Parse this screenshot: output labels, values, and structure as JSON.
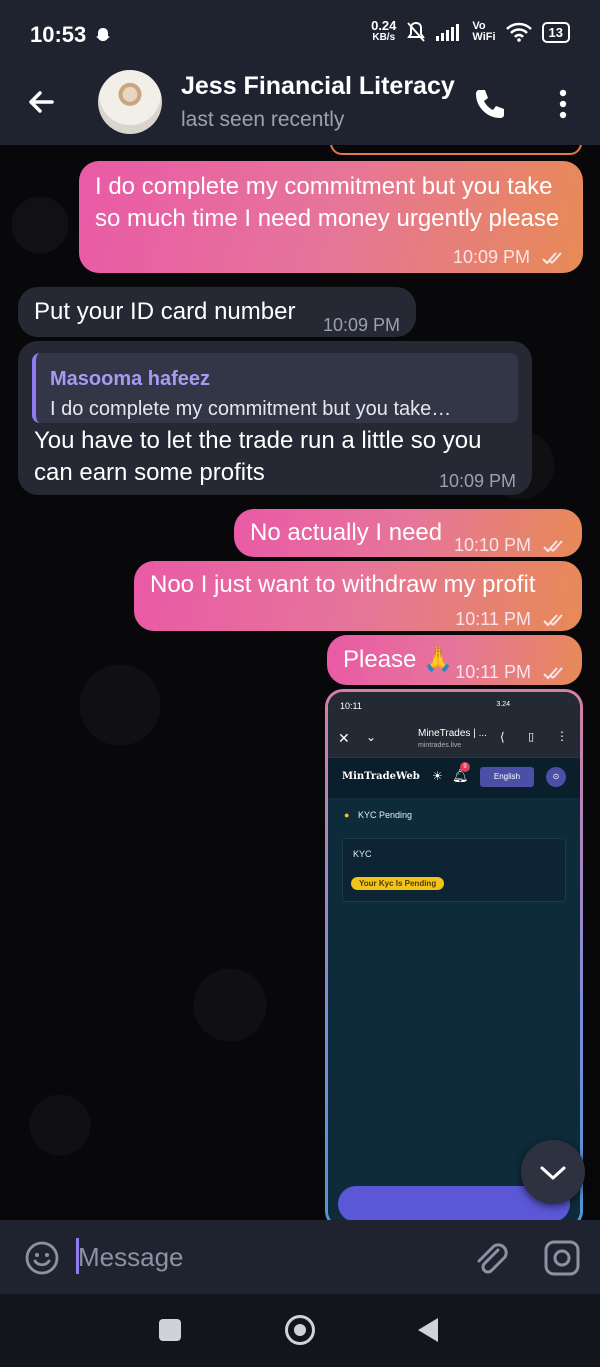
{
  "status_bar": {
    "time": "10:53",
    "net_speed_value": "0.24",
    "net_speed_unit": "KB/s",
    "carrier_top": "Vo",
    "carrier_bottom": "WiFi",
    "battery": "13"
  },
  "header": {
    "title": "Jess Financial Literacy",
    "subtitle": "last seen recently"
  },
  "messages": [
    {
      "dir": "out",
      "text": "I do complete my commitment but you take so much time I need money urgently please",
      "time": "10:09 PM"
    },
    {
      "dir": "in",
      "text": "Put your ID card number",
      "time": "10:09 PM"
    },
    {
      "dir": "in",
      "reply_author": "Masooma hafeez",
      "reply_text": "I do complete my commitment but you take…",
      "text": "You have to let the trade run a little so you can earn some profits",
      "time": "10:09 PM"
    },
    {
      "dir": "out",
      "text": "No actually I need",
      "time": "10:10 PM"
    },
    {
      "dir": "out",
      "text": "Noo I just want to withdraw my profit",
      "time": "10:11 PM"
    },
    {
      "dir": "out",
      "text": "Please 🙏",
      "time": "10:11 PM"
    }
  ],
  "screenshot_msg": {
    "status_time": "10:11",
    "net": "3.24",
    "site_title": "MineTrades | ...",
    "site_url": "mintrades.live",
    "brand": "MinTradeWeb",
    "notif_count": "9",
    "language": "English",
    "section_title": "KYC Pending",
    "card_title": "KYC",
    "badge": "Your Kyc Is Pending"
  },
  "input": {
    "placeholder": "Message"
  },
  "colors": {
    "accent": "#8f7cf0",
    "out_gradient_start": "#e95aa6",
    "out_gradient_end": "#e78a56",
    "in_bubble": "#262834",
    "header_bg": "#1f2330"
  },
  "icons": [
    "back-arrow-icon",
    "phone-icon",
    "more-vert-icon",
    "emoji-icon",
    "paperclip-icon",
    "camera-icon",
    "chevron-down-icon",
    "double-check-icon"
  ]
}
